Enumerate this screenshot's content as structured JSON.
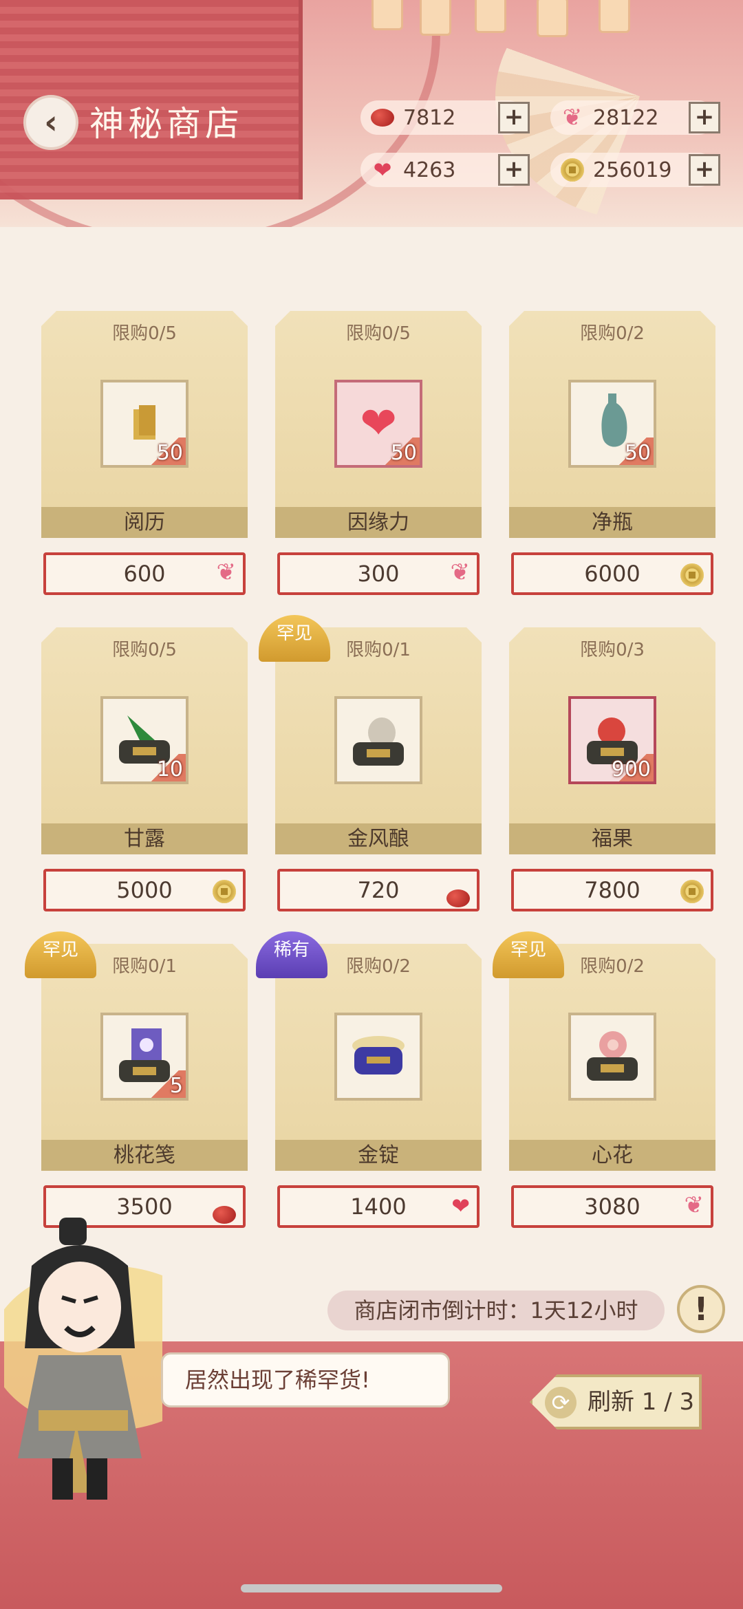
{
  "header": {
    "title": "神秘商店",
    "back_icon": "back-arrow-icon"
  },
  "currencies": [
    {
      "icon": "red-bean-icon",
      "value": "7812"
    },
    {
      "icon": "butterfly-icon",
      "value": "28122"
    },
    {
      "icon": "heart-icon",
      "value": "4263"
    },
    {
      "icon": "coin-icon",
      "value": "256019"
    }
  ],
  "plus_label": "+",
  "items": [
    {
      "limit": "限购0/5",
      "name": "阅历",
      "qty": "50",
      "price": "600",
      "price_icon": "butterfly-icon",
      "badge": ""
    },
    {
      "limit": "限购0/5",
      "name": "因缘力",
      "qty": "50",
      "price": "300",
      "price_icon": "butterfly-icon",
      "badge": ""
    },
    {
      "limit": "限购0/2",
      "name": "净瓶",
      "qty": "50",
      "price": "6000",
      "price_icon": "coin-icon",
      "badge": ""
    },
    {
      "limit": "限购0/5",
      "name": "甘露",
      "qty": "10",
      "price": "5000",
      "price_icon": "coin-icon",
      "badge": ""
    },
    {
      "limit": "限购0/1",
      "name": "金风酿",
      "qty": "",
      "price": "720",
      "price_icon": "red-bean-icon",
      "badge": "罕见"
    },
    {
      "limit": "限购0/3",
      "name": "福果",
      "qty": "900",
      "price": "7800",
      "price_icon": "coin-icon",
      "badge": ""
    },
    {
      "limit": "限购0/1",
      "name": "桃花笺",
      "qty": "5",
      "price": "3500",
      "price_icon": "red-bean-icon",
      "badge": "罕见"
    },
    {
      "limit": "限购0/2",
      "name": "金锭",
      "qty": "",
      "price": "1400",
      "price_icon": "heart-icon",
      "badge": "稀有"
    },
    {
      "limit": "限购0/2",
      "name": "心花",
      "qty": "",
      "price": "3080",
      "price_icon": "butterfly-icon",
      "badge": "罕见"
    }
  ],
  "countdown": "商店闭市倒计时：1天12小时",
  "info_label": "!",
  "speech": "居然出现了稀罕货!",
  "refresh": {
    "label": "刷新 1 / 3",
    "icon_glyph": "⟳"
  },
  "colors": {
    "accent_red": "#c7413c",
    "card_gold": "#e9d5a3",
    "header_pink": "#e9a3a0"
  }
}
